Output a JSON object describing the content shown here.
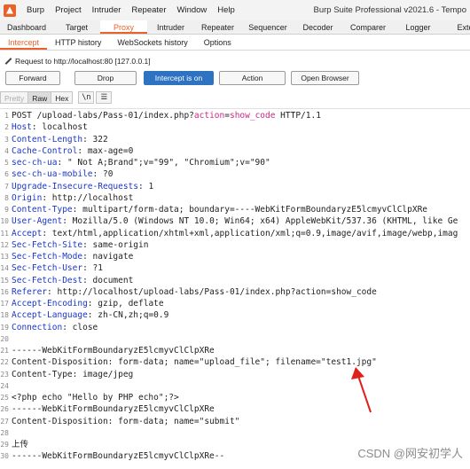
{
  "menubar": {
    "items": [
      "Burp",
      "Project",
      "Intruder",
      "Repeater",
      "Window",
      "Help"
    ],
    "title": "Burp Suite Professional v2021.6 - Tempo"
  },
  "main_tabs": [
    "Dashboard",
    "Target",
    "Proxy",
    "Intruder",
    "Repeater",
    "Sequencer",
    "Decoder",
    "Comparer",
    "Logger",
    "Exte"
  ],
  "main_tab_active": "Proxy",
  "sub_tabs": [
    "Intercept",
    "HTTP history",
    "WebSockets history",
    "Options"
  ],
  "request_label": "Request to http://localhost:80  [127.0.0.1]",
  "buttons": {
    "forward": "Forward",
    "drop": "Drop",
    "intercept": "Intercept is on",
    "action": "Action",
    "browser": "Open Browser"
  },
  "view_modes": [
    "Pretty",
    "Raw",
    "Hex"
  ],
  "view_active": "Raw",
  "newline_toggle": "\\n",
  "menu_glyph": "☰",
  "request_line": {
    "prefix": "POST /upload-labs/Pass-01/index.php?",
    "param_name": "action",
    "eq": "=",
    "param_value": "show_code",
    "suffix": " HTTP/1.1"
  },
  "headers": [
    {
      "name": "Host",
      "value": " localhost"
    },
    {
      "name": "Content-Length",
      "value": " 322"
    },
    {
      "name": "Cache-Control",
      "value": " max-age=0"
    },
    {
      "name": "sec-ch-ua",
      "value": " \" Not A;Brand\";v=\"99\", \"Chromium\";v=\"90\""
    },
    {
      "name": "sec-ch-ua-mobile",
      "value": " ?0"
    },
    {
      "name": "Upgrade-Insecure-Requests",
      "value": " 1"
    },
    {
      "name": "Origin",
      "value": " http://localhost"
    },
    {
      "name": "Content-Type",
      "value": " multipart/form-data; boundary=----WebKitFormBoundaryzE5lcmyvClClpXRe"
    },
    {
      "name": "User-Agent",
      "value": " Mozilla/5.0 (Windows NT 10.0; Win64; x64) AppleWebKit/537.36 (KHTML, like Ge"
    },
    {
      "name": "Accept",
      "value": " text/html,application/xhtml+xml,application/xml;q=0.9,image/avif,image/webp,imag"
    },
    {
      "name": "Sec-Fetch-Site",
      "value": " same-origin"
    },
    {
      "name": "Sec-Fetch-Mode",
      "value": " navigate"
    },
    {
      "name": "Sec-Fetch-User",
      "value": " ?1"
    },
    {
      "name": "Sec-Fetch-Dest",
      "value": " document"
    },
    {
      "name": "Referer",
      "value": " http://localhost/upload-labs/Pass-01/index.php?action=show_code"
    },
    {
      "name": "Accept-Encoding",
      "value": " gzip, deflate"
    },
    {
      "name": "Accept-Language",
      "value": " zh-CN,zh;q=0.9"
    },
    {
      "name": "Connection",
      "value": " close"
    }
  ],
  "body_lines": [
    "",
    "------WebKitFormBoundaryzE5lcmyvClClpXRe",
    "Content-Disposition: form-data; name=\"upload_file\"; filename=\"test1.jpg\"",
    "Content-Type: image/jpeg",
    "",
    "<?php echo \"Hello by PHP echo\";?>",
    "------WebKitFormBoundaryzE5lcmyvClClpXRe",
    "Content-Disposition: form-data; name=\"submit\"",
    "",
    "上传",
    "------WebKitFormBoundaryzE5lcmyvClClpXRe--"
  ],
  "line_numbers": [
    "1",
    "2",
    "3",
    "4",
    "5",
    "6",
    "7",
    "8",
    "9",
    "10",
    "11",
    "12",
    "13",
    "14",
    "15",
    "16",
    "17",
    "18",
    "19",
    "20",
    "21",
    "22",
    "23",
    "24",
    "25",
    "26",
    "27",
    "28",
    "29",
    "30"
  ],
  "arrow_color": "#e0201b",
  "accent_color": "#e8622a",
  "header_name_color": "#1b36c8",
  "watermark": "CSDN @网安初学人"
}
